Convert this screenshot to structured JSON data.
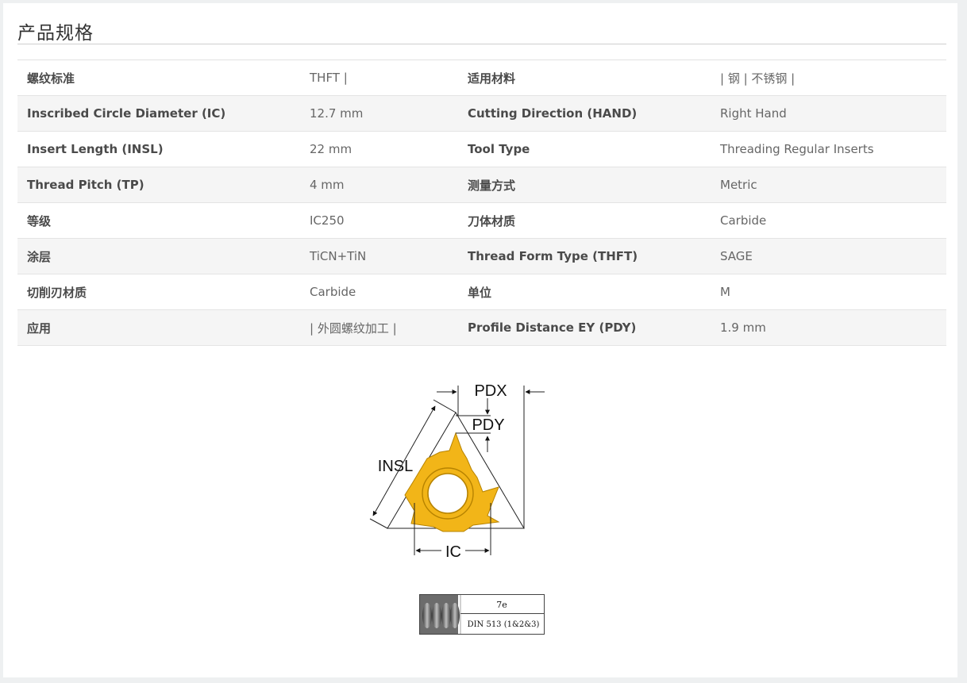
{
  "section": {
    "title": "产品规格"
  },
  "specs": [
    {
      "k1": "螺纹标准",
      "v1": "THFT |",
      "k2": "适用材料",
      "v2": "| 钢 | 不锈钢 |"
    },
    {
      "k1": "Inscribed Circle Diameter (IC)",
      "v1": "12.7 mm",
      "k2": "Cutting Direction (HAND)",
      "v2": "Right Hand"
    },
    {
      "k1": "Insert Length (INSL)",
      "v1": "22 mm",
      "k2": "Tool Type",
      "v2": "Threading Regular Inserts"
    },
    {
      "k1": "Thread Pitch (TP)",
      "v1": "4 mm",
      "k2": "测量方式",
      "v2": "Metric"
    },
    {
      "k1": "等级",
      "v1": "IC250",
      "k2": "刀体材质",
      "v2": "Carbide"
    },
    {
      "k1": "涂层",
      "v1": "TiCN+TiN",
      "k2": "Thread Form Type (THFT)",
      "v2": "SAGE"
    },
    {
      "k1": "切削刃材质",
      "v1": "Carbide",
      "k2": "单位",
      "v2": "M"
    },
    {
      "k1": "应用",
      "v1": "| 外圆螺纹加工 |",
      "k2": "Profile Distance EY (PDY)",
      "v2": "1.9 mm"
    }
  ],
  "diagram": {
    "pdx_label": "PDX",
    "pdy_label": "PDY",
    "insl_label": "INSL",
    "ic_label": "IC",
    "insert_color": "#f2b518"
  },
  "standard": {
    "tolerance": "7e",
    "name": "DIN 513 (1&2&3)"
  }
}
